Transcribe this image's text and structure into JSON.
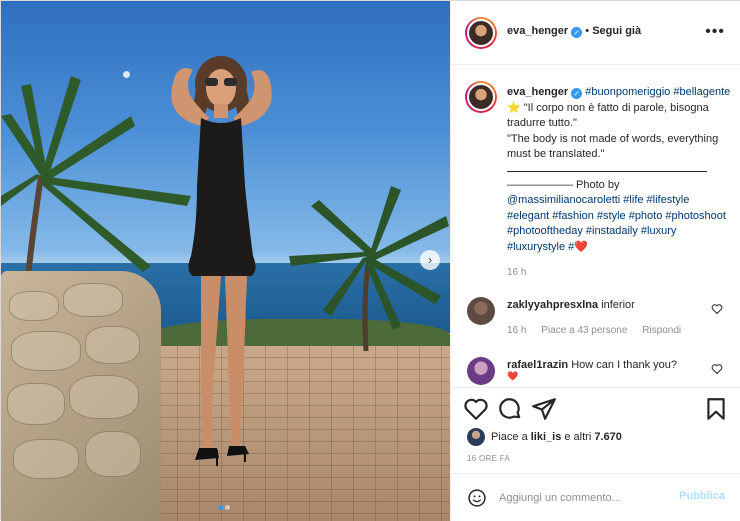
{
  "post": {
    "username": "eva_henger",
    "follow_label": "Segui già",
    "more_label": "•••"
  },
  "caption": {
    "username": "eva_henger",
    "tags_line1": "#buonpomeriggio",
    "tags_line2": "#bellagente",
    "emoji_star": "⭐",
    "text_it": "\"Il corpo non è fatto di parole, bisogna tradurre tutto.\"",
    "text_en": "\"The body is not made of words, everything must be translated.\"",
    "photo_by_label": "—————— Photo by",
    "credit_tags": "@massimilianocaroletti #life #lifestyle #elegant #fashion #style #photo #photoshoot #photooftheday #instadaily #luxury #luxurystyle #",
    "heart_emoji": "❤️",
    "time": "16 h"
  },
  "comments": [
    {
      "username": "zaklyyahpresxlna",
      "text": "inferior",
      "time": "16 h",
      "likes": "Piace a 43 persone",
      "reply_label": "Rispondi"
    },
    {
      "username": "rafael1razin",
      "text": "How can I thank you?",
      "emoji": "❤️"
    }
  ],
  "likes": {
    "prefix": "Piace a ",
    "user": "liki_is",
    "suffix": " e altri ",
    "count": "7.670"
  },
  "date": "16 ORE FA",
  "comment_box": {
    "placeholder": "Aggiungi un commento...",
    "publish_label": "Pubblica"
  },
  "icons": {
    "verified": "verified-badge",
    "like": "heart-icon",
    "comment": "comment-icon",
    "share": "share-icon",
    "save": "bookmark-icon",
    "emoji": "emoji-icon",
    "more": "more-icon",
    "next": "chevron-right-icon"
  },
  "colors": {
    "link": "#00376b",
    "verified": "#3897f0",
    "publish_disabled": "#b2dffc",
    "muted": "#8e8e8e"
  },
  "carousel": {
    "slides": 2,
    "active": 1
  }
}
